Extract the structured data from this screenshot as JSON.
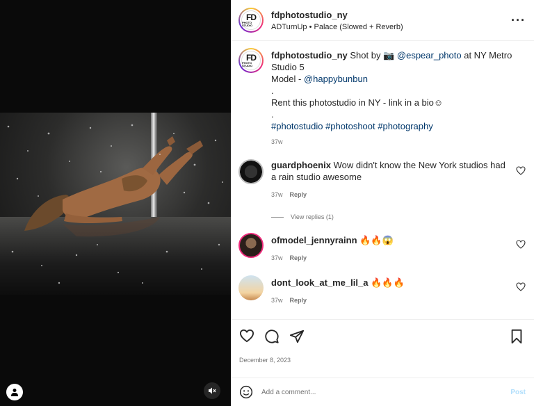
{
  "media": {
    "mute_icon": "speaker-muted-icon",
    "user_icon": "person-icon"
  },
  "header": {
    "username": "fdphotostudio_ny",
    "song": "ADTurnUp • Palace (Slowed + Reverb)",
    "logo_big": "FD",
    "logo_small": "PHOTO STUDIO",
    "more_icon": "more-horizontal-icon"
  },
  "caption": {
    "username": "fdphotostudio_ny",
    "line1_a": "Shot by 📷 ",
    "line1_mention": "@espear_photo",
    "line1_b": " at NY Metro Studio 5",
    "line2_a": "Model - ",
    "line2_mention": "@happybunbun",
    "dot1": ".",
    "line3": "Rent this photostudio in NY - link in a bio☺",
    "dot2": ".",
    "hashtags": "#photostudio #photoshoot #photography",
    "time": "37w"
  },
  "comments": [
    {
      "username": "guardphoenix",
      "text": "Wow didn't know the New York studios had a rain studio awesome",
      "time": "37w",
      "reply": "Reply"
    },
    {
      "username": "ofmodel_jennyrainn",
      "text": "🔥🔥😱",
      "time": "37w",
      "reply": "Reply"
    },
    {
      "username": "dont_look_at_me_lil_a",
      "text": "🔥🔥🔥",
      "time": "37w",
      "reply": "Reply"
    }
  ],
  "view_replies": "View replies (1)",
  "date": "December 8, 2023",
  "add_comment": {
    "placeholder": "Add a comment...",
    "post_label": "Post"
  },
  "colors": {
    "link": "#00376b",
    "muted": "#737373",
    "post_disabled": "#b2dffc"
  }
}
